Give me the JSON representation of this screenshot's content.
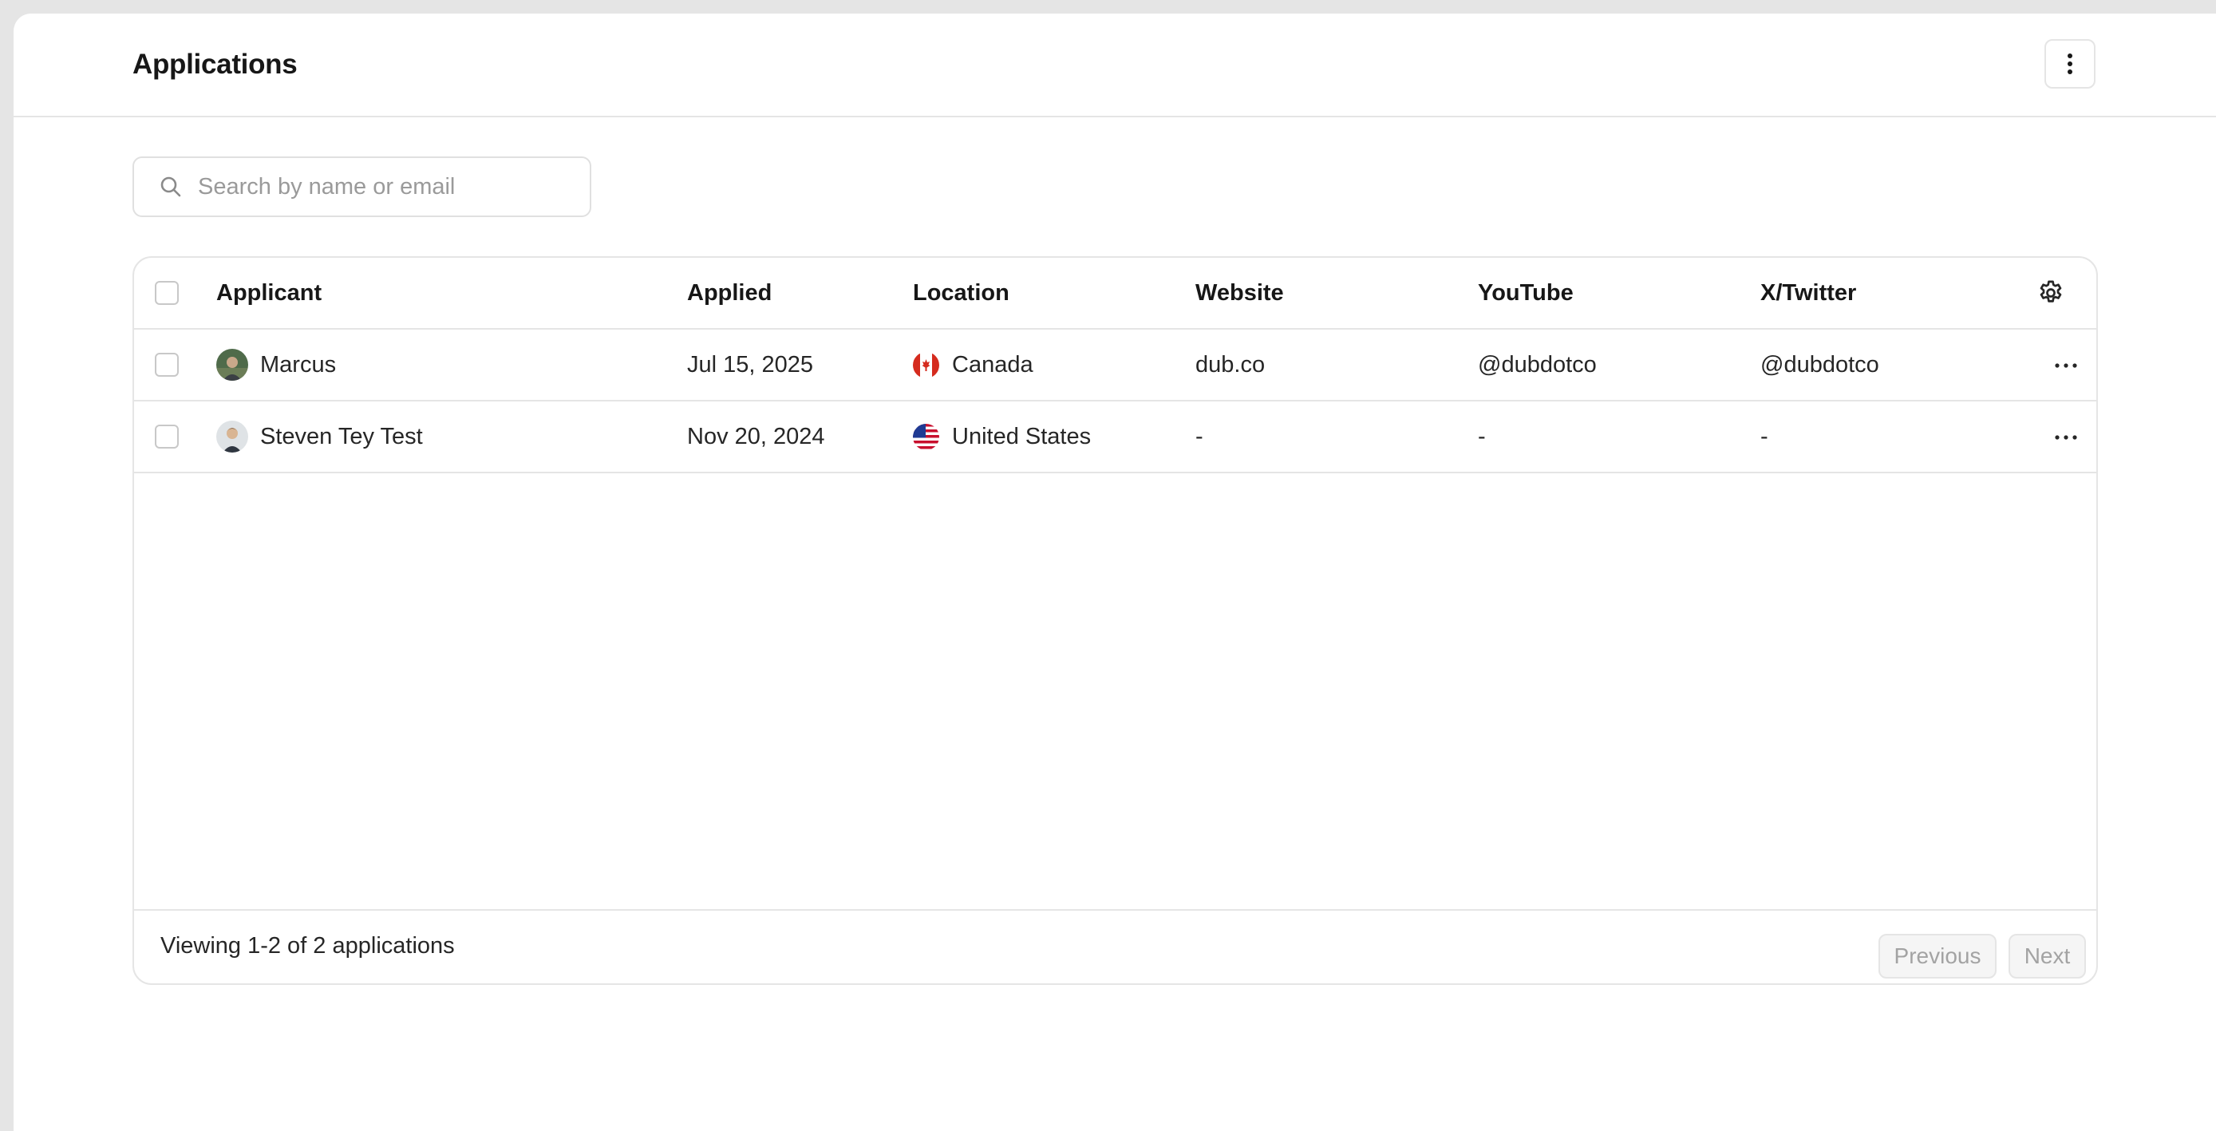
{
  "header": {
    "title": "Applications"
  },
  "search": {
    "placeholder": "Search by name or email"
  },
  "table": {
    "columns": [
      "Applicant",
      "Applied",
      "Location",
      "Website",
      "YouTube",
      "X/Twitter"
    ],
    "rows": [
      {
        "name": "Marcus",
        "applied": "Jul 15, 2025",
        "location": "Canada",
        "website": "dub.co",
        "youtube": "@dubdotco",
        "twitter": "@dubdotco"
      },
      {
        "name": "Steven Tey Test",
        "applied": "Nov 20, 2024",
        "location": "United States",
        "website": "-",
        "youtube": "-",
        "twitter": "-"
      }
    ]
  },
  "footer": {
    "summary": "Viewing 1-2 of 2 applications",
    "previous_label": "Previous",
    "next_label": "Next"
  },
  "icons": {
    "header_menu": "vertical-ellipsis-icon",
    "search": "search-icon",
    "settings": "gear-icon",
    "row_menu": "horizontal-ellipsis-icon"
  }
}
